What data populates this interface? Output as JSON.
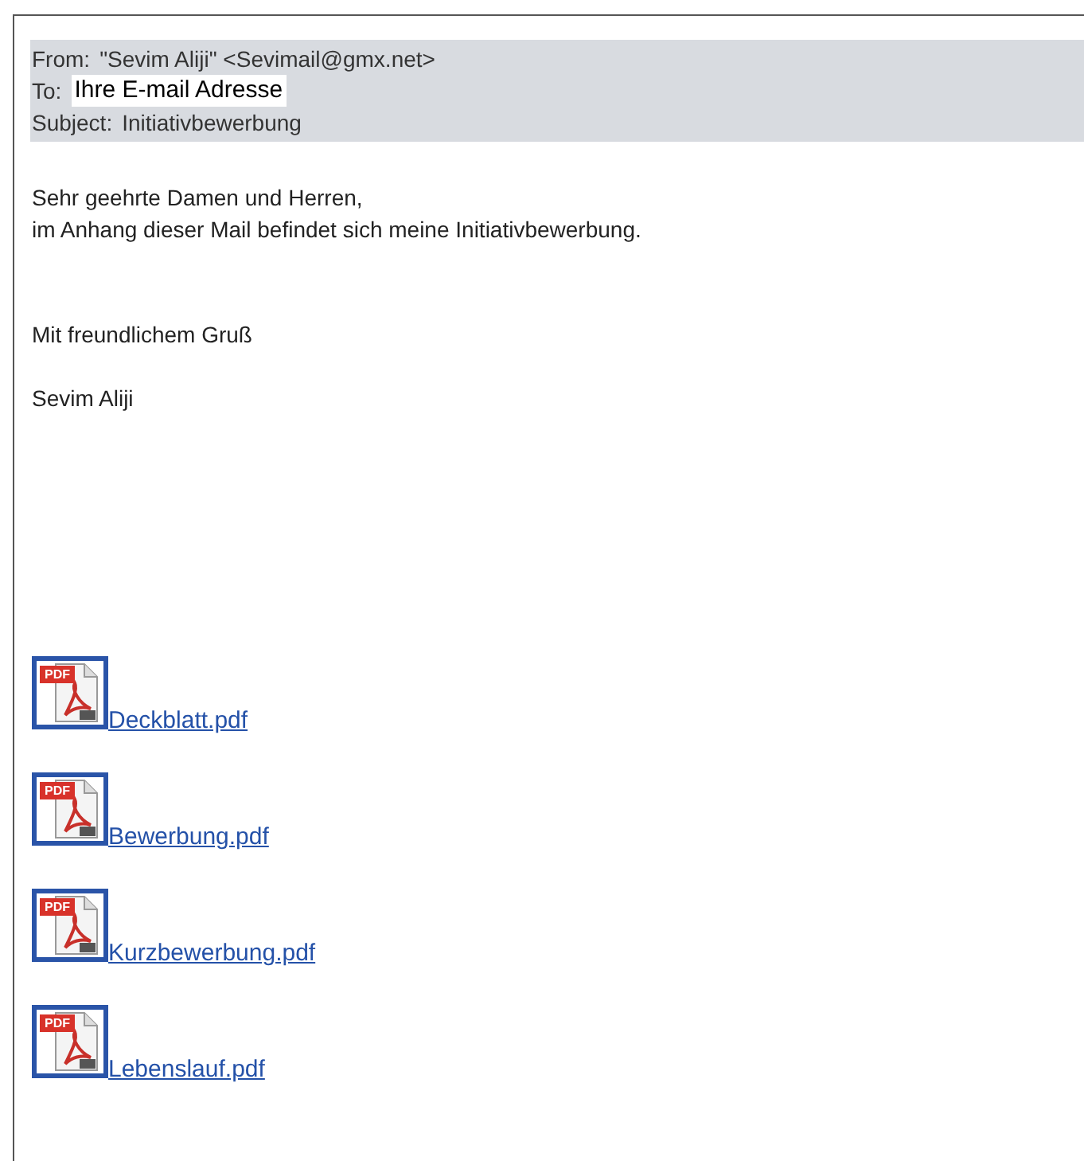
{
  "header": {
    "from_label": "From:",
    "from_value": "\"Sevim Aliji\" <Sevimail@gmx.net>",
    "to_label": "To:",
    "to_value": "Ihre E-mail Adresse",
    "subject_label": "Subject:",
    "subject_value": "Initiativbewerbung"
  },
  "body": [
    [
      "Sehr geehrte Damen und Herren,",
      "im Anhang dieser Mail befindet sich meine Initiativbewerbung."
    ],
    [
      "Mit freundlichem Gruß"
    ],
    [
      "Sevim Aliji"
    ]
  ],
  "attachments": [
    {
      "name": "Deckblatt.pdf",
      "icon_label": "PDF"
    },
    {
      "name": "Bewerbung.pdf",
      "icon_label": "PDF"
    },
    {
      "name": "Kurzbewerbung.pdf",
      "icon_label": "PDF"
    },
    {
      "name": "Lebenslauf.pdf",
      "icon_label": "PDF"
    }
  ]
}
